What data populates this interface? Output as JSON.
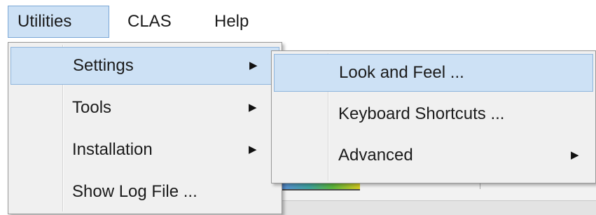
{
  "menubar": {
    "items": [
      {
        "label": "Utilities"
      },
      {
        "label": "CLAS"
      },
      {
        "label": "Help"
      }
    ]
  },
  "utilities_menu": {
    "items": [
      {
        "label": "Settings",
        "submenu_arrow": "▶"
      },
      {
        "label": "Tools",
        "submenu_arrow": "▶"
      },
      {
        "label": "Installation",
        "submenu_arrow": "▶"
      },
      {
        "label": "Show Log File ..."
      }
    ]
  },
  "settings_submenu": {
    "items": [
      {
        "label": "Look and Feel ..."
      },
      {
        "label": "Keyboard Shortcuts ..."
      },
      {
        "label": "Advanced",
        "submenu_arrow": "▶"
      }
    ]
  },
  "colors": {
    "highlight": "#cde1f5",
    "highlight_border": "#8fb5dc",
    "menu_background": "#f0f0f0"
  },
  "icons": {
    "submenu_arrow": "submenu-arrow-icon"
  }
}
